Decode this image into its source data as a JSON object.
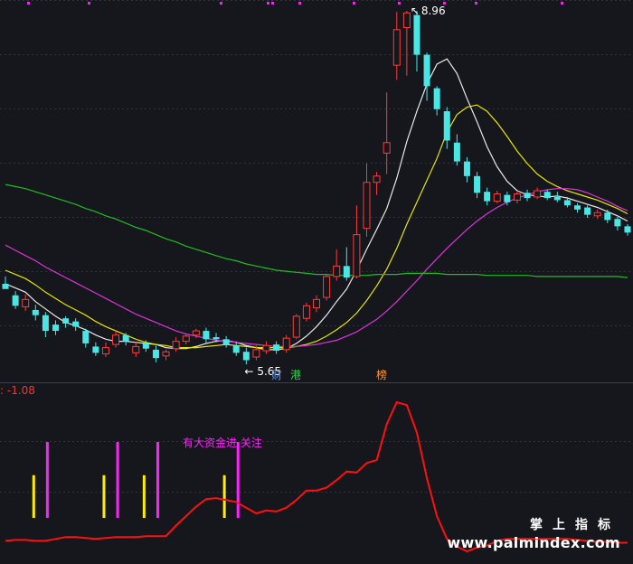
{
  "chart_data": [
    {
      "type": "candlestick",
      "panel": "main",
      "annotations": {
        "high_label": "8.96",
        "low_label": "5.65",
        "markers": [
          {
            "text": "财",
            "color": "#4f9bff"
          },
          {
            "text": "港",
            "color": "#39d353"
          },
          {
            "text": "榜",
            "color": "#ff9933"
          }
        ]
      },
      "candles": [
        [
          6.35,
          6.3,
          6.33,
          6.42
        ],
        [
          6.24,
          6.14,
          6.11,
          6.28
        ],
        [
          6.13,
          6.2,
          6.09,
          6.25
        ],
        [
          6.1,
          6.05,
          6.0,
          6.15
        ],
        [
          6.05,
          5.9,
          5.84,
          6.08
        ],
        [
          5.96,
          5.9,
          5.86,
          6.0
        ],
        [
          6.02,
          5.97,
          5.93,
          6.04
        ],
        [
          5.99,
          5.94,
          5.9,
          6.02
        ],
        [
          5.9,
          5.78,
          5.74,
          5.92
        ],
        [
          5.75,
          5.69,
          5.66,
          5.79
        ],
        [
          5.68,
          5.74,
          5.65,
          5.79
        ],
        [
          5.77,
          5.86,
          5.74,
          5.9
        ],
        [
          5.86,
          5.8,
          5.76,
          5.88
        ],
        [
          5.69,
          5.75,
          5.65,
          5.79
        ],
        [
          5.78,
          5.73,
          5.7,
          5.81
        ],
        [
          5.72,
          5.64,
          5.6,
          5.76
        ],
        [
          5.66,
          5.7,
          5.62,
          5.72
        ],
        [
          5.73,
          5.8,
          5.7,
          5.84
        ],
        [
          5.8,
          5.85,
          5.77,
          5.87
        ],
        [
          5.86,
          5.9,
          5.83,
          5.92
        ],
        [
          5.9,
          5.82,
          5.78,
          5.93
        ],
        [
          5.84,
          5.82,
          5.79,
          5.88
        ],
        [
          5.82,
          5.77,
          5.74,
          5.85
        ],
        [
          5.76,
          5.69,
          5.66,
          5.8
        ],
        [
          5.7,
          5.62,
          5.58,
          5.74
        ],
        [
          5.65,
          5.72,
          5.62,
          5.76
        ],
        [
          5.71,
          5.76,
          5.68,
          5.8
        ],
        [
          5.77,
          5.71,
          5.68,
          5.8
        ],
        [
          5.72,
          5.83,
          5.69,
          5.86
        ],
        [
          5.84,
          6.04,
          5.82,
          6.06
        ],
        [
          6.02,
          6.14,
          5.99,
          6.17
        ],
        [
          6.12,
          6.2,
          6.08,
          6.24
        ],
        [
          6.22,
          6.42,
          6.19,
          6.44
        ],
        [
          6.42,
          6.52,
          6.38,
          6.68
        ],
        [
          6.52,
          6.41,
          6.38,
          6.7
        ],
        [
          6.42,
          6.82,
          6.4,
          7.1
        ],
        [
          6.88,
          7.32,
          6.8,
          7.5
        ],
        [
          7.32,
          7.38,
          7.2,
          7.42
        ],
        [
          7.6,
          7.7,
          7.4,
          8.18
        ],
        [
          8.44,
          8.78,
          8.3,
          8.95
        ],
        [
          8.8,
          8.94,
          8.34,
          8.96
        ],
        [
          8.92,
          8.54,
          8.38,
          8.96
        ],
        [
          8.54,
          8.24,
          8.1,
          8.56
        ],
        [
          8.22,
          8.02,
          7.96,
          8.24
        ],
        [
          8.0,
          7.72,
          7.64,
          8.04
        ],
        [
          7.7,
          7.52,
          7.48,
          7.78
        ],
        [
          7.52,
          7.38,
          7.32,
          7.56
        ],
        [
          7.38,
          7.22,
          7.17,
          7.42
        ],
        [
          7.23,
          7.14,
          7.1,
          7.27
        ],
        [
          7.14,
          7.21,
          7.12,
          7.24
        ],
        [
          7.2,
          7.13,
          7.1,
          7.23
        ],
        [
          7.15,
          7.21,
          7.12,
          7.24
        ],
        [
          7.22,
          7.17,
          7.14,
          7.25
        ],
        [
          7.18,
          7.24,
          7.16,
          7.27
        ],
        [
          7.23,
          7.17,
          7.15,
          7.25
        ],
        [
          7.18,
          7.15,
          7.13,
          7.23
        ],
        [
          7.15,
          7.1,
          7.08,
          7.18
        ],
        [
          7.1,
          7.06,
          7.03,
          7.12
        ],
        [
          7.08,
          7.01,
          6.98,
          7.1
        ],
        [
          7.0,
          7.03,
          6.97,
          7.06
        ],
        [
          7.03,
          6.96,
          6.93,
          7.06
        ],
        [
          6.97,
          6.9,
          6.86,
          6.99
        ],
        [
          6.9,
          6.84,
          6.81,
          6.92
        ]
      ],
      "ma": [
        {
          "color": "#e8e8e8",
          "values": [
            6.35,
            6.31,
            6.27,
            6.18,
            6.11,
            6.04,
            5.98,
            5.95,
            5.91,
            5.86,
            5.82,
            5.8,
            5.8,
            5.79,
            5.78,
            5.77,
            5.74,
            5.73,
            5.73,
            5.75,
            5.78,
            5.8,
            5.81,
            5.79,
            5.76,
            5.74,
            5.72,
            5.72,
            5.73,
            5.78,
            5.85,
            5.94,
            6.05,
            6.18,
            6.3,
            6.48,
            6.68,
            6.87,
            7.07,
            7.36,
            7.71,
            8.0,
            8.26,
            8.45,
            8.5,
            8.36,
            8.12,
            7.9,
            7.66,
            7.47,
            7.33,
            7.24,
            7.2,
            7.19,
            7.18,
            7.19,
            7.17,
            7.14,
            7.11,
            7.08,
            7.04,
            7.0,
            6.95
          ]
        },
        {
          "color": "#e6e600",
          "values": [
            6.48,
            6.44,
            6.4,
            6.34,
            6.27,
            6.21,
            6.15,
            6.1,
            6.05,
            5.99,
            5.94,
            5.9,
            5.86,
            5.82,
            5.79,
            5.77,
            5.76,
            5.74,
            5.74,
            5.74,
            5.75,
            5.76,
            5.77,
            5.76,
            5.75,
            5.74,
            5.74,
            5.74,
            5.74,
            5.75,
            5.77,
            5.8,
            5.85,
            5.91,
            5.98,
            6.07,
            6.19,
            6.33,
            6.49,
            6.69,
            6.92,
            7.13,
            7.34,
            7.55,
            7.8,
            7.97,
            8.04,
            8.06,
            8.0,
            7.89,
            7.76,
            7.62,
            7.5,
            7.4,
            7.33,
            7.28,
            7.24,
            7.21,
            7.18,
            7.15,
            7.11,
            7.07,
            7.02
          ]
        },
        {
          "color": "#dd33dd",
          "values": [
            6.72,
            6.67,
            6.62,
            6.57,
            6.51,
            6.46,
            6.41,
            6.36,
            6.31,
            6.26,
            6.21,
            6.16,
            6.11,
            6.06,
            6.02,
            5.98,
            5.94,
            5.9,
            5.87,
            5.85,
            5.83,
            5.81,
            5.8,
            5.79,
            5.78,
            5.77,
            5.76,
            5.75,
            5.75,
            5.75,
            5.76,
            5.77,
            5.79,
            5.81,
            5.85,
            5.89,
            5.95,
            6.01,
            6.09,
            6.18,
            6.28,
            6.38,
            6.49,
            6.59,
            6.69,
            6.78,
            6.87,
            6.95,
            7.02,
            7.08,
            7.13,
            7.17,
            7.2,
            7.23,
            7.25,
            7.26,
            7.26,
            7.25,
            7.22,
            7.18,
            7.14,
            7.09,
            7.05
          ]
        },
        {
          "color": "#22bb22",
          "values": [
            7.3,
            7.28,
            7.26,
            7.23,
            7.2,
            7.17,
            7.14,
            7.11,
            7.07,
            7.04,
            7.0,
            6.97,
            6.93,
            6.89,
            6.86,
            6.82,
            6.78,
            6.75,
            6.71,
            6.68,
            6.65,
            6.62,
            6.59,
            6.57,
            6.54,
            6.52,
            6.5,
            6.48,
            6.47,
            6.46,
            6.45,
            6.44,
            6.44,
            6.43,
            6.43,
            6.43,
            6.43,
            6.44,
            6.44,
            6.44,
            6.45,
            6.45,
            6.45,
            6.45,
            6.44,
            6.44,
            6.44,
            6.44,
            6.43,
            6.43,
            6.43,
            6.43,
            6.43,
            6.42,
            6.42,
            6.42,
            6.42,
            6.42,
            6.42,
            6.42,
            6.42,
            6.42,
            6.41
          ]
        }
      ]
    },
    {
      "type": "line",
      "panel": "indicator",
      "title_value": ": -1.08",
      "signal_label": "有大资金进 关注",
      "line_color": "#ff1010",
      "values": [
        0.9,
        1.0,
        1.0,
        0.9,
        0.9,
        1.1,
        1.3,
        1.3,
        1.2,
        1.1,
        1.2,
        1.3,
        1.3,
        1.3,
        1.4,
        1.4,
        1.4,
        2.5,
        3.5,
        4.5,
        5.3,
        5.4,
        5.2,
        5.0,
        4.4,
        3.8,
        4.1,
        4.0,
        4.4,
        5.2,
        6.2,
        6.2,
        6.5,
        7.3,
        8.2,
        8.1,
        9.1,
        9.4,
        13.2,
        15.5,
        15.2,
        12.3,
        7.5,
        3.5,
        1.1,
        0.3,
        -0.2,
        0.2,
        0.4,
        0.9,
        1.1,
        1.1,
        1.1,
        1.1,
        1.1,
        1.1,
        1.1,
        1.0,
        0.9,
        0.8,
        0.8,
        0.7,
        0.7
      ],
      "signals": [
        {
          "index": 3,
          "color": "#ffee00",
          "height": 0.45
        },
        {
          "index": 4,
          "color": "#ff22ff",
          "height": 0.8
        },
        {
          "index": 10,
          "color": "#ffee00",
          "height": 0.45
        },
        {
          "index": 11,
          "color": "#ff22ff",
          "height": 0.8
        },
        {
          "index": 14,
          "color": "#ffee00",
          "height": 0.45
        },
        {
          "index": 15,
          "color": "#ff22ff",
          "height": 0.8
        },
        {
          "index": 22,
          "color": "#ffee00",
          "height": 0.45
        },
        {
          "index": 23,
          "color": "#ff22ff",
          "height": 0.8
        }
      ]
    }
  ],
  "watermark": {
    "title": "掌上指标",
    "url": "www.palmindex.com"
  }
}
